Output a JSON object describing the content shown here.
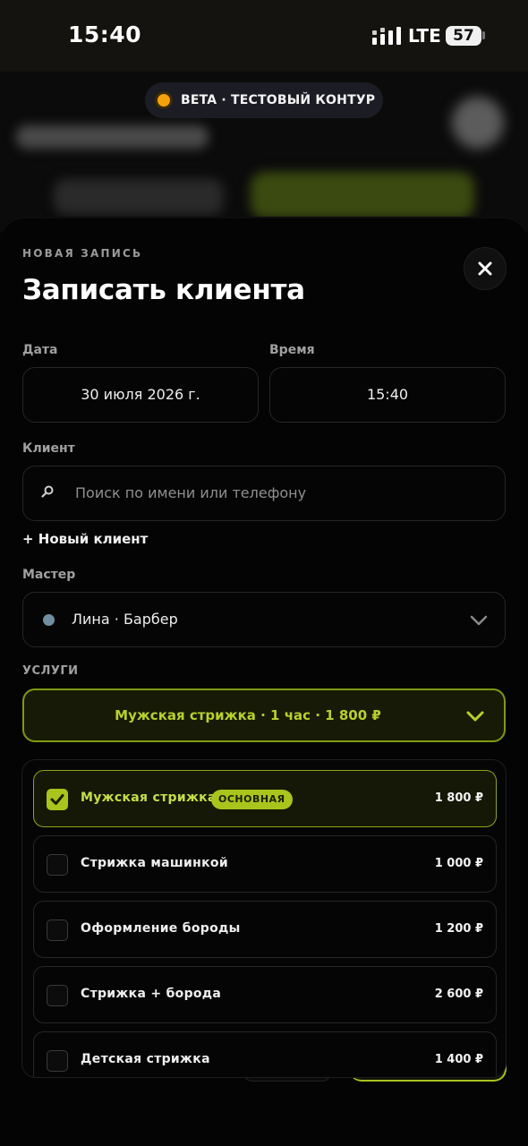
{
  "status_bar": {
    "time": "15:40",
    "network": "LTE",
    "battery": "57"
  },
  "beta_badge": {
    "text": "BETA · ТЕСТОВЫЙ КОНТУР",
    "dot_color": "#f5a20a"
  },
  "sheet": {
    "eyebrow": "НОВАЯ ЗАПИСЬ",
    "title": "Записать клиента",
    "close_icon": "close-icon"
  },
  "date": {
    "label": "Дата",
    "value": "30 июля 2026 г."
  },
  "time_field": {
    "label": "Время",
    "value": "15:40"
  },
  "client": {
    "label": "Клиент",
    "placeholder": "Поиск по имени или телефону",
    "new_client": "+ Новый клиент"
  },
  "master": {
    "label": "Мастер",
    "value": "Лина · Барбер",
    "dot_color": "#6f8fa0"
  },
  "services": {
    "label": "УСЛУГИ",
    "summary": "Мужская стрижка · 1 час · 1 800 ₽",
    "accent": "#a9c41d",
    "items": [
      {
        "name": "Мужская стрижка",
        "badge": "ОСНОВНАЯ",
        "price": "1 800 ₽",
        "checked": true
      },
      {
        "name": "Стрижка машинкой",
        "price": "1 000 ₽",
        "checked": false
      },
      {
        "name": "Оформление бороды",
        "price": "1 200 ₽",
        "checked": false
      },
      {
        "name": "Стрижка + борода",
        "price": "2 600 ₽",
        "checked": false
      },
      {
        "name": "Детская стрижка",
        "price": "1 400 ₽",
        "checked": false
      }
    ]
  }
}
